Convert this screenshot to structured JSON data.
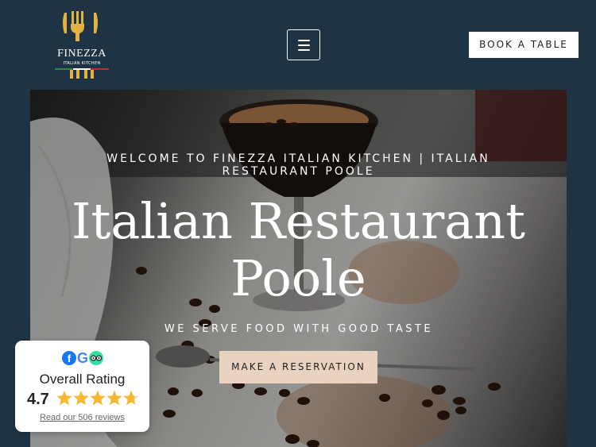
{
  "brand": {
    "name": "FINEZZA",
    "subtitle": "ITALIAN KITCHEN",
    "gold": "#e3b341",
    "flag_colors": [
      "#2e8b3e",
      "#ffffff",
      "#c8282e"
    ]
  },
  "header": {
    "menu_icon": "hamburger-icon",
    "book_label": "BOOK A TABLE"
  },
  "hero": {
    "eyebrow": "WELCOME TO FINEZZA ITALIAN KITCHEN | ITALIAN RESTAURANT POOLE",
    "title": "Italian Restaurant Poole",
    "tagline": "WE SERVE FOOD WITH GOOD TASTE",
    "cta_label": "MAKE A RESERVATION",
    "cta_color": "#ead2c0"
  },
  "rating_widget": {
    "icons": [
      "facebook-icon",
      "google-icon",
      "tripadvisor-icon"
    ],
    "label": "Overall Rating",
    "score": "4.7",
    "stars": 4.7,
    "max_stars": 5,
    "reviews_link": "Read our 506 reviews",
    "star_color": "#f5b82e"
  }
}
